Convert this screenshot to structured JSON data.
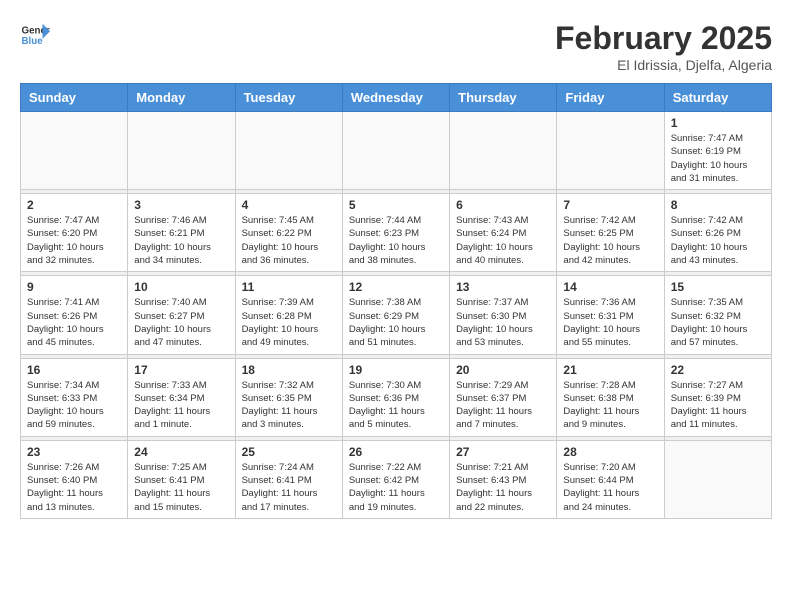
{
  "header": {
    "logo_line1": "General",
    "logo_line2": "Blue",
    "title": "February 2025",
    "subtitle": "El Idrissia, Djelfa, Algeria"
  },
  "weekdays": [
    "Sunday",
    "Monday",
    "Tuesday",
    "Wednesday",
    "Thursday",
    "Friday",
    "Saturday"
  ],
  "weeks": [
    [
      {
        "day": "",
        "info": ""
      },
      {
        "day": "",
        "info": ""
      },
      {
        "day": "",
        "info": ""
      },
      {
        "day": "",
        "info": ""
      },
      {
        "day": "",
        "info": ""
      },
      {
        "day": "",
        "info": ""
      },
      {
        "day": "1",
        "info": "Sunrise: 7:47 AM\nSunset: 6:19 PM\nDaylight: 10 hours and 31 minutes."
      }
    ],
    [
      {
        "day": "2",
        "info": "Sunrise: 7:47 AM\nSunset: 6:20 PM\nDaylight: 10 hours and 32 minutes."
      },
      {
        "day": "3",
        "info": "Sunrise: 7:46 AM\nSunset: 6:21 PM\nDaylight: 10 hours and 34 minutes."
      },
      {
        "day": "4",
        "info": "Sunrise: 7:45 AM\nSunset: 6:22 PM\nDaylight: 10 hours and 36 minutes."
      },
      {
        "day": "5",
        "info": "Sunrise: 7:44 AM\nSunset: 6:23 PM\nDaylight: 10 hours and 38 minutes."
      },
      {
        "day": "6",
        "info": "Sunrise: 7:43 AM\nSunset: 6:24 PM\nDaylight: 10 hours and 40 minutes."
      },
      {
        "day": "7",
        "info": "Sunrise: 7:42 AM\nSunset: 6:25 PM\nDaylight: 10 hours and 42 minutes."
      },
      {
        "day": "8",
        "info": "Sunrise: 7:42 AM\nSunset: 6:26 PM\nDaylight: 10 hours and 43 minutes."
      }
    ],
    [
      {
        "day": "9",
        "info": "Sunrise: 7:41 AM\nSunset: 6:26 PM\nDaylight: 10 hours and 45 minutes."
      },
      {
        "day": "10",
        "info": "Sunrise: 7:40 AM\nSunset: 6:27 PM\nDaylight: 10 hours and 47 minutes."
      },
      {
        "day": "11",
        "info": "Sunrise: 7:39 AM\nSunset: 6:28 PM\nDaylight: 10 hours and 49 minutes."
      },
      {
        "day": "12",
        "info": "Sunrise: 7:38 AM\nSunset: 6:29 PM\nDaylight: 10 hours and 51 minutes."
      },
      {
        "day": "13",
        "info": "Sunrise: 7:37 AM\nSunset: 6:30 PM\nDaylight: 10 hours and 53 minutes."
      },
      {
        "day": "14",
        "info": "Sunrise: 7:36 AM\nSunset: 6:31 PM\nDaylight: 10 hours and 55 minutes."
      },
      {
        "day": "15",
        "info": "Sunrise: 7:35 AM\nSunset: 6:32 PM\nDaylight: 10 hours and 57 minutes."
      }
    ],
    [
      {
        "day": "16",
        "info": "Sunrise: 7:34 AM\nSunset: 6:33 PM\nDaylight: 10 hours and 59 minutes."
      },
      {
        "day": "17",
        "info": "Sunrise: 7:33 AM\nSunset: 6:34 PM\nDaylight: 11 hours and 1 minute."
      },
      {
        "day": "18",
        "info": "Sunrise: 7:32 AM\nSunset: 6:35 PM\nDaylight: 11 hours and 3 minutes."
      },
      {
        "day": "19",
        "info": "Sunrise: 7:30 AM\nSunset: 6:36 PM\nDaylight: 11 hours and 5 minutes."
      },
      {
        "day": "20",
        "info": "Sunrise: 7:29 AM\nSunset: 6:37 PM\nDaylight: 11 hours and 7 minutes."
      },
      {
        "day": "21",
        "info": "Sunrise: 7:28 AM\nSunset: 6:38 PM\nDaylight: 11 hours and 9 minutes."
      },
      {
        "day": "22",
        "info": "Sunrise: 7:27 AM\nSunset: 6:39 PM\nDaylight: 11 hours and 11 minutes."
      }
    ],
    [
      {
        "day": "23",
        "info": "Sunrise: 7:26 AM\nSunset: 6:40 PM\nDaylight: 11 hours and 13 minutes."
      },
      {
        "day": "24",
        "info": "Sunrise: 7:25 AM\nSunset: 6:41 PM\nDaylight: 11 hours and 15 minutes."
      },
      {
        "day": "25",
        "info": "Sunrise: 7:24 AM\nSunset: 6:41 PM\nDaylight: 11 hours and 17 minutes."
      },
      {
        "day": "26",
        "info": "Sunrise: 7:22 AM\nSunset: 6:42 PM\nDaylight: 11 hours and 19 minutes."
      },
      {
        "day": "27",
        "info": "Sunrise: 7:21 AM\nSunset: 6:43 PM\nDaylight: 11 hours and 22 minutes."
      },
      {
        "day": "28",
        "info": "Sunrise: 7:20 AM\nSunset: 6:44 PM\nDaylight: 11 hours and 24 minutes."
      },
      {
        "day": "",
        "info": ""
      }
    ]
  ]
}
